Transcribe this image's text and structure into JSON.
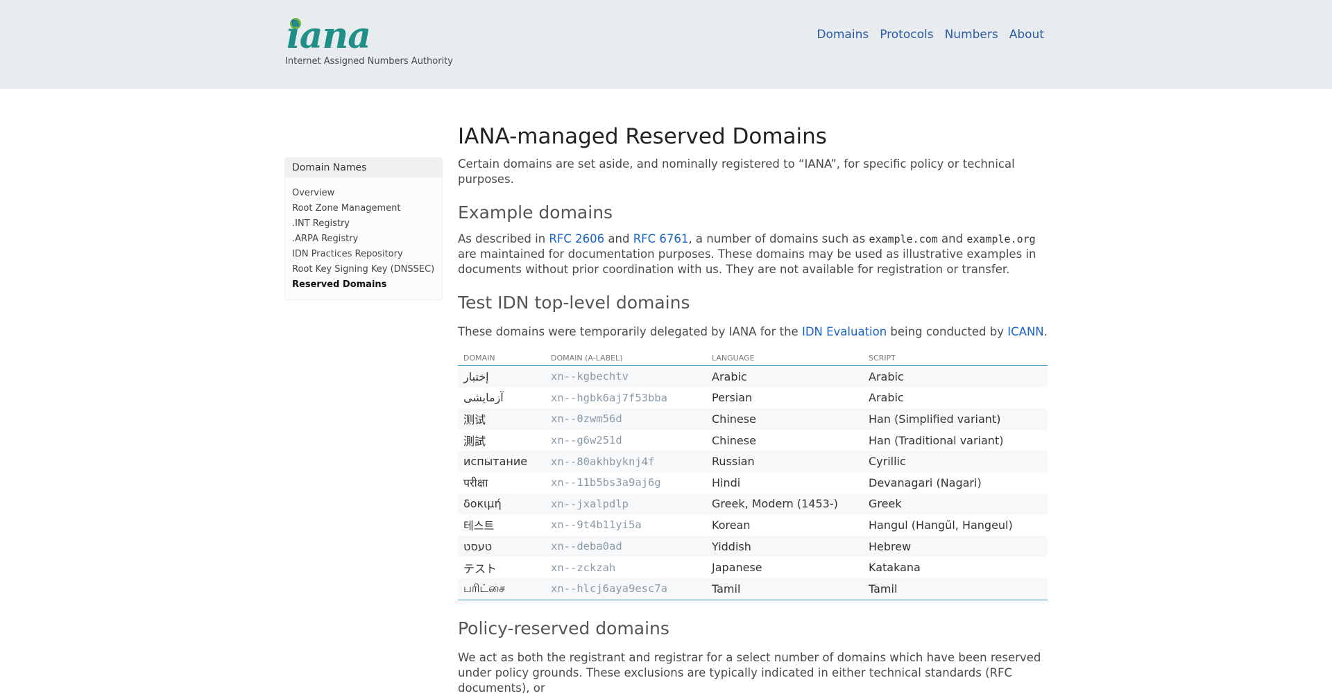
{
  "header": {
    "logo_text": "iana",
    "logo_tagline": "Internet Assigned Numbers Authority",
    "nav": [
      "Domains",
      "Protocols",
      "Numbers",
      "About"
    ]
  },
  "sidebar": {
    "heading": "Domain Names",
    "items": [
      "Overview",
      "Root Zone Management",
      ".INT Registry",
      ".ARPA Registry",
      "IDN Practices Repository",
      "Root Key Signing Key (DNSSEC)",
      "Reserved Domains"
    ],
    "active": "Reserved Domains"
  },
  "main": {
    "title": "IANA-managed Reserved Domains",
    "intro": "Certain domains are set aside, and nominally registered to “IANA”, for specific policy or technical purposes.",
    "example": {
      "heading": "Example domains",
      "t1": "As described in ",
      "link1": "RFC 2606",
      "t2": " and ",
      "link2": "RFC 6761",
      "t3": ", a number of domains such as ",
      "code1": "example.com",
      "t4": " and ",
      "code2": "example.org",
      "t5": " are maintained for documentation purposes. These domains may be used as illustrative examples in documents without prior coordination with us. They are not available for registration or transfer."
    },
    "idn": {
      "heading": "Test IDN top-level domains",
      "t1": "These domains were temporarily delegated by IANA for the ",
      "link1": "IDN Evaluation",
      "t2": " being conducted by ",
      "link2": "ICANN",
      "t3": "."
    },
    "table": {
      "headers": [
        "Domain",
        "Domain (A-label)",
        "Language",
        "Script"
      ],
      "rows": [
        [
          "إختبار",
          "xn--kgbechtv",
          "Arabic",
          "Arabic"
        ],
        [
          "آزمایشی",
          "xn--hgbk6aj7f53bba",
          "Persian",
          "Arabic"
        ],
        [
          "测试",
          "xn--0zwm56d",
          "Chinese",
          "Han (Simplified variant)"
        ],
        [
          "測試",
          "xn--g6w251d",
          "Chinese",
          "Han (Traditional variant)"
        ],
        [
          "испытание",
          "xn--80akhbyknj4f",
          "Russian",
          "Cyrillic"
        ],
        [
          "परीक्षा",
          "xn--11b5bs3a9aj6g",
          "Hindi",
          "Devanagari (Nagari)"
        ],
        [
          "δοκιμή",
          "xn--jxalpdlp",
          "Greek, Modern (1453-)",
          "Greek"
        ],
        [
          "테스트",
          "xn--9t4b11yi5a",
          "Korean",
          "Hangul (Hangŭl, Hangeul)"
        ],
        [
          "טעסט",
          "xn--deba0ad",
          "Yiddish",
          "Hebrew"
        ],
        [
          "テスト",
          "xn--zckzah",
          "Japanese",
          "Katakana"
        ],
        [
          "பரிட்சை",
          "xn--hlcj6aya9esc7a",
          "Tamil",
          "Tamil"
        ]
      ]
    },
    "policy": {
      "heading": "Policy-reserved domains",
      "text": "We act as both the registrant and registrar for a select number of domains which have been reserved under policy grounds. These exclusions are typically indicated in either technical standards (RFC documents), or"
    }
  }
}
